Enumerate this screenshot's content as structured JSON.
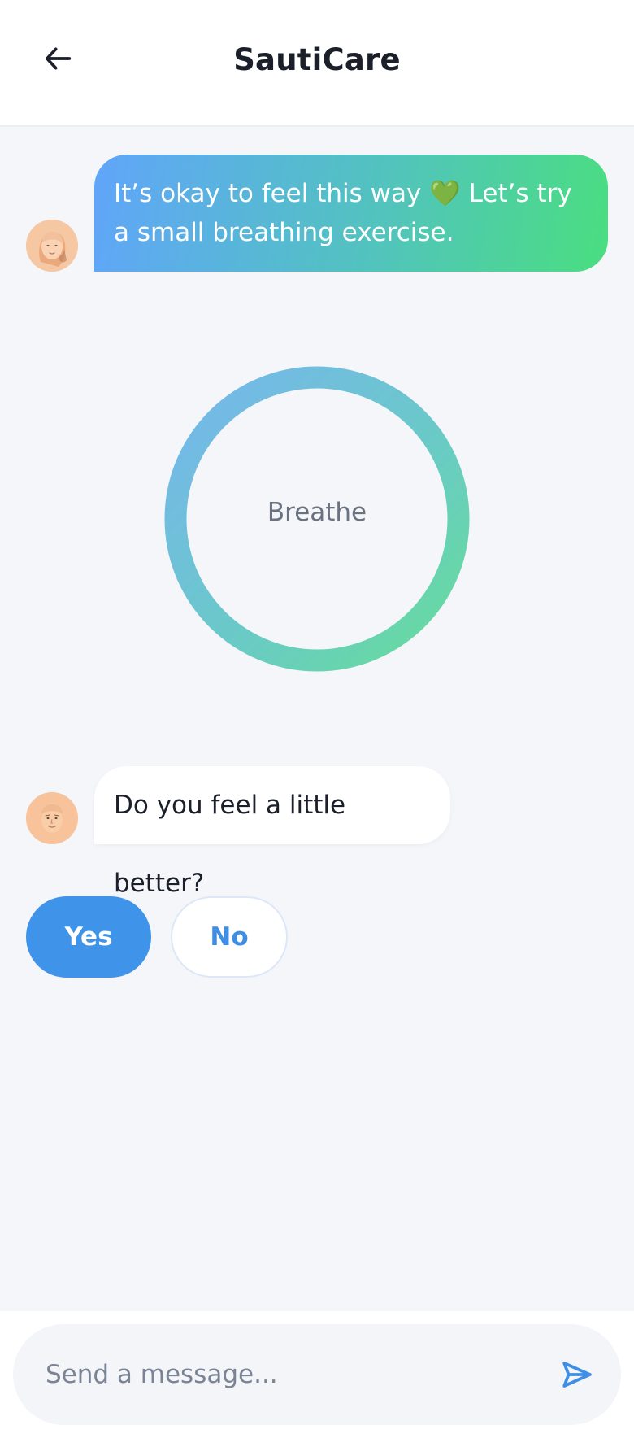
{
  "header": {
    "title": "SautiCare",
    "back_icon": "arrow-left-icon"
  },
  "messages": [
    {
      "text": "It’s okay to feel this way 💚 Let’s try a small breathing exercise."
    },
    {
      "text": "Do you feel a little better?"
    }
  ],
  "breathing": {
    "label": "Breathe"
  },
  "quick_replies": {
    "yes": "Yes",
    "no": "No"
  },
  "composer": {
    "placeholder": "Send a message...",
    "value": ""
  },
  "colors": {
    "accent": "#3F93E8",
    "gradient_start": "#60A5FA",
    "gradient_end": "#4ADE80"
  }
}
